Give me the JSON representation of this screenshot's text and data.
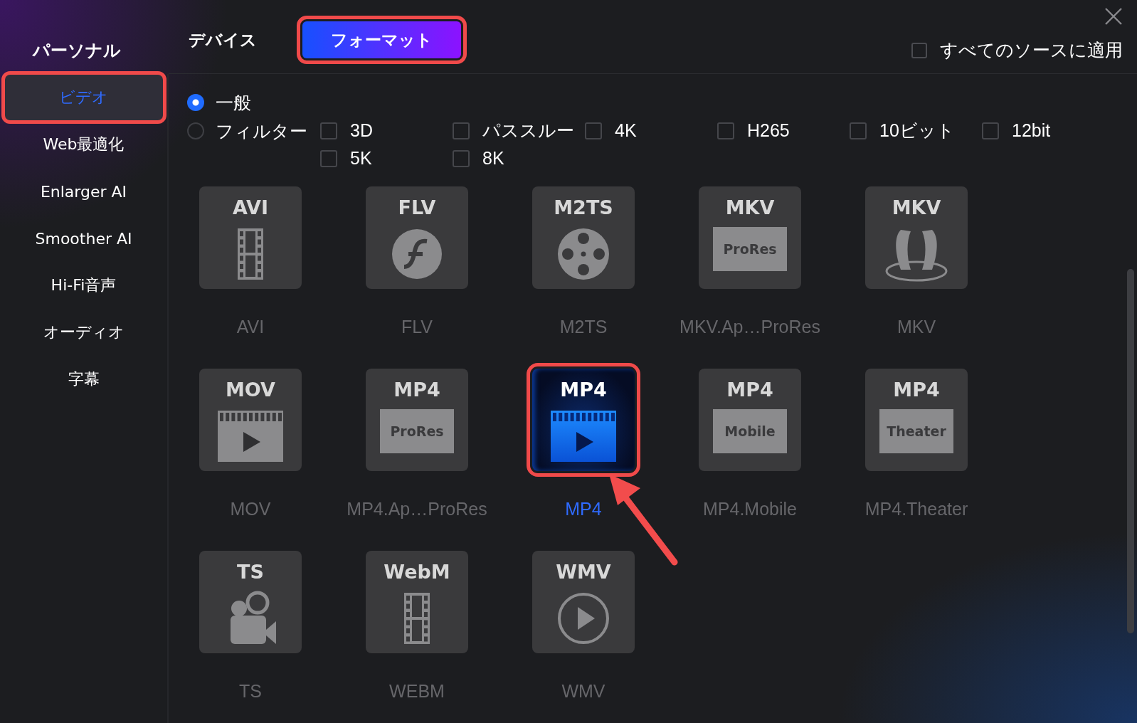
{
  "sidebar": {
    "title": "パーソナル",
    "items": [
      {
        "label": "ビデオ",
        "selected": true,
        "highlighted": true
      },
      {
        "label": "Web最適化",
        "selected": false,
        "highlighted": false
      },
      {
        "label": "Enlarger AI",
        "selected": false,
        "highlighted": false
      },
      {
        "label": "Smoother AI",
        "selected": false,
        "highlighted": false
      },
      {
        "label": "Hi-Fi音声",
        "selected": false,
        "highlighted": false
      },
      {
        "label": "オーディオ",
        "selected": false,
        "highlighted": false
      },
      {
        "label": "字幕",
        "selected": false,
        "highlighted": false
      }
    ]
  },
  "tabs": [
    {
      "label": "デバイス",
      "selected": false,
      "highlighted": false
    },
    {
      "label": "フォーマット",
      "selected": true,
      "highlighted": true
    }
  ],
  "apply_all": {
    "label": "すべてのソースに適用",
    "checked": false
  },
  "modes": [
    {
      "label": "一般",
      "selected": true
    },
    {
      "label": "フィルター",
      "selected": false
    }
  ],
  "filters": [
    {
      "label": "3D",
      "checked": false
    },
    {
      "label": "パススルー",
      "checked": false
    },
    {
      "label": "4K",
      "checked": false
    },
    {
      "label": "H265",
      "checked": false
    },
    {
      "label": "10ビット",
      "checked": false
    },
    {
      "label": "12bit",
      "checked": false
    },
    {
      "label": "5K",
      "checked": false
    },
    {
      "label": "8K",
      "checked": false
    }
  ],
  "formats": [
    {
      "title": "AVI",
      "kind": "film",
      "label": "AVI",
      "selected": false,
      "highlighted": false
    },
    {
      "title": "FLV",
      "kind": "flash",
      "label": "FLV",
      "selected": false,
      "highlighted": false
    },
    {
      "title": "M2TS",
      "kind": "reel",
      "label": "M2TS",
      "selected": false,
      "highlighted": false
    },
    {
      "title": "MKV",
      "kind": "badge",
      "badge": "ProRes",
      "label": "MKV.Ap…ProRes",
      "selected": false,
      "highlighted": false
    },
    {
      "title": "MKV",
      "kind": "mask",
      "label": "MKV",
      "selected": false,
      "highlighted": false
    },
    {
      "title": "MOV",
      "kind": "clapper",
      "label": "MOV",
      "selected": false,
      "highlighted": false
    },
    {
      "title": "MP4",
      "kind": "badge",
      "badge": "ProRes",
      "label": "MP4.Ap…ProRes",
      "selected": false,
      "highlighted": false
    },
    {
      "title": "MP4",
      "kind": "clapper",
      "label": "MP4",
      "selected": true,
      "highlighted": true
    },
    {
      "title": "MP4",
      "kind": "badge",
      "badge": "Mobile",
      "label": "MP4.Mobile",
      "selected": false,
      "highlighted": false
    },
    {
      "title": "MP4",
      "kind": "badge",
      "badge": "Theater",
      "label": "MP4.Theater",
      "selected": false,
      "highlighted": false
    },
    {
      "title": "TS",
      "kind": "camera",
      "label": "TS",
      "selected": false,
      "highlighted": false
    },
    {
      "title": "WebM",
      "kind": "film",
      "label": "WEBM",
      "selected": false,
      "highlighted": false
    },
    {
      "title": "WMV",
      "kind": "play",
      "label": "WMV",
      "selected": false,
      "highlighted": false
    }
  ]
}
